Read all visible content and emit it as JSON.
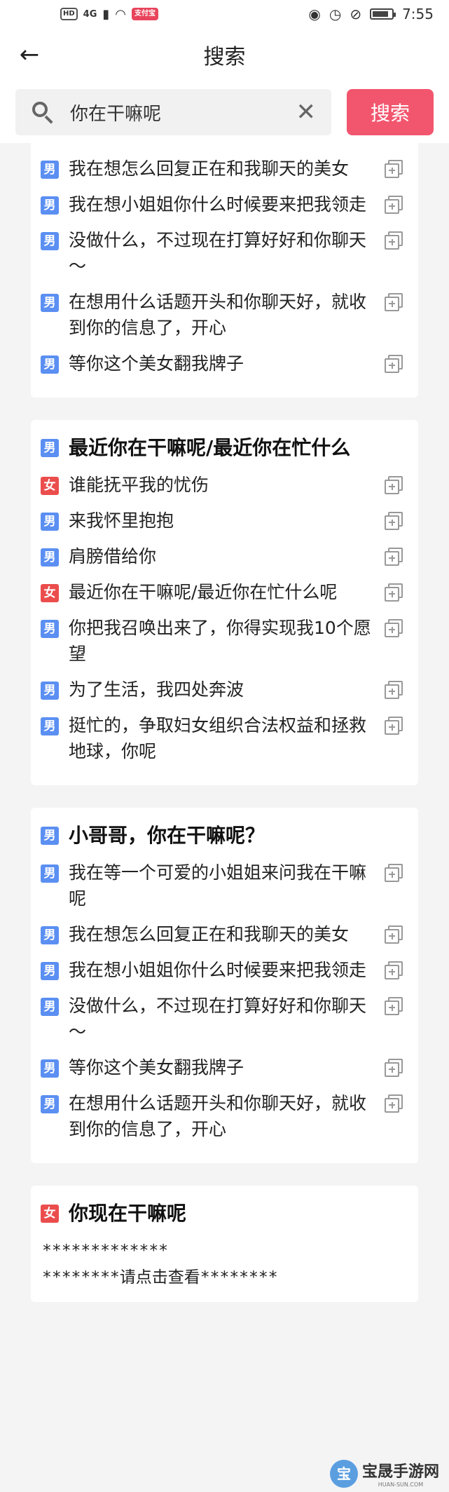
{
  "statusbar": {
    "left_pills": [
      "HD",
      "支付宝"
    ],
    "network": "4G",
    "time": "7:55",
    "battery_level": 0.85
  },
  "navbar": {
    "back_icon": "back-arrow-icon",
    "title": "搜索"
  },
  "search": {
    "value": "你在干嘛呢",
    "clear_icon": "close-icon",
    "button_label": "搜索"
  },
  "cards": [
    {
      "title": null,
      "rows": [
        {
          "gender": "男",
          "text": "我在想怎么回复正在和我聊天的美女"
        },
        {
          "gender": "男",
          "text": "我在想小姐姐你什么时候要来把我领走"
        },
        {
          "gender": "男",
          "text": "没做什么，不过现在打算好好和你聊天～"
        },
        {
          "gender": "男",
          "text": "在想用什么话题开头和你聊天好，就收到你的信息了，开心"
        },
        {
          "gender": "男",
          "text": "等你这个美女翻我牌子"
        }
      ]
    },
    {
      "title": {
        "gender": "男",
        "text": "最近你在干嘛呢/最近你在忙什么"
      },
      "rows": [
        {
          "gender": "女",
          "text": "谁能抚平我的忧伤"
        },
        {
          "gender": "男",
          "text": "来我怀里抱抱"
        },
        {
          "gender": "男",
          "text": "肩膀借给你"
        },
        {
          "gender": "女",
          "text": "最近你在干嘛呢/最近你在忙什么呢"
        },
        {
          "gender": "男",
          "text": "你把我召唤出来了，你得实现我10个愿望"
        },
        {
          "gender": "男",
          "text": "为了生活，我四处奔波"
        },
        {
          "gender": "男",
          "text": "挺忙的，争取妇女组织合法权益和拯救地球，你呢"
        }
      ]
    },
    {
      "title": {
        "gender": "男",
        "text": "小哥哥，你在干嘛呢？"
      },
      "rows": [
        {
          "gender": "男",
          "text": "我在等一个可爱的小姐姐来问我在干嘛呢"
        },
        {
          "gender": "男",
          "text": "我在想怎么回复正在和我聊天的美女"
        },
        {
          "gender": "男",
          "text": "我在想小姐姐你什么时候要来把我领走"
        },
        {
          "gender": "男",
          "text": "没做什么，不过现在打算好好和你聊天～"
        },
        {
          "gender": "男",
          "text": "等你这个美女翻我牌子"
        },
        {
          "gender": "男",
          "text": "在想用什么话题开头和你聊天好，就收到你的信息了，开心"
        }
      ]
    },
    {
      "title": {
        "gender": "女",
        "text": "你现在干嘛呢"
      },
      "locked_lines": [
        "*************",
        "********请点击查看********"
      ]
    }
  ],
  "watermark": {
    "text": "宝晟手游网",
    "sub": "HUAN-SUN.COM"
  },
  "colors": {
    "male_badge": "#5b8ff2",
    "female_badge": "#eb4d4d",
    "search_button": "#f2566e"
  }
}
